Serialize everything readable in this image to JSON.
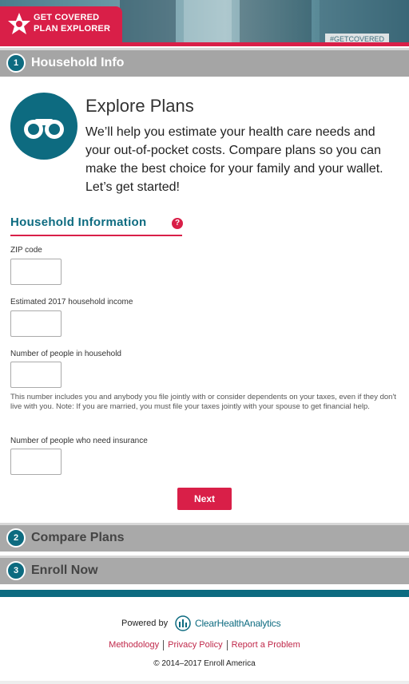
{
  "header": {
    "logo_line1": "GET COVERED",
    "logo_line2": "PLAN EXPLORER",
    "hashtag": "#GETCOVERED"
  },
  "steps": [
    {
      "number": "1",
      "label": "Household Info"
    },
    {
      "number": "2",
      "label": "Compare Plans"
    },
    {
      "number": "3",
      "label": "Enroll Now"
    }
  ],
  "intro": {
    "title": "Explore Plans",
    "text": "We’ll help you estimate your health care needs and your out-of-pocket costs. Compare plans so you can make the best choice for your family and your wallet. Let’s get started!",
    "icon": "binoculars-icon"
  },
  "section": {
    "title": "Household Information",
    "help_symbol": "?"
  },
  "form": {
    "zip_label": "ZIP code",
    "zip_value": "",
    "income_label": "Estimated 2017 household income",
    "income_value": "",
    "household_label": "Number of people in household",
    "household_value": "",
    "household_help": "This number includes you and anybody you file jointly with or consider dependents on your taxes, even if they don't live with you. Note: If you are married, you must file your taxes jointly with your spouse to get financial help.",
    "insured_label": "Number of people who need insurance",
    "insured_value": "",
    "next_label": "Next"
  },
  "footer": {
    "powered_by": "Powered by",
    "brand": "ClearHealthAnalytics",
    "links": [
      "Methodology",
      "Privacy Policy",
      "Report a Problem"
    ],
    "copyright": "© 2014–2017 Enroll America"
  },
  "colors": {
    "brand_red": "#d91f48",
    "brand_teal": "#0d6b80",
    "step_gray": "#a9a9a9"
  }
}
